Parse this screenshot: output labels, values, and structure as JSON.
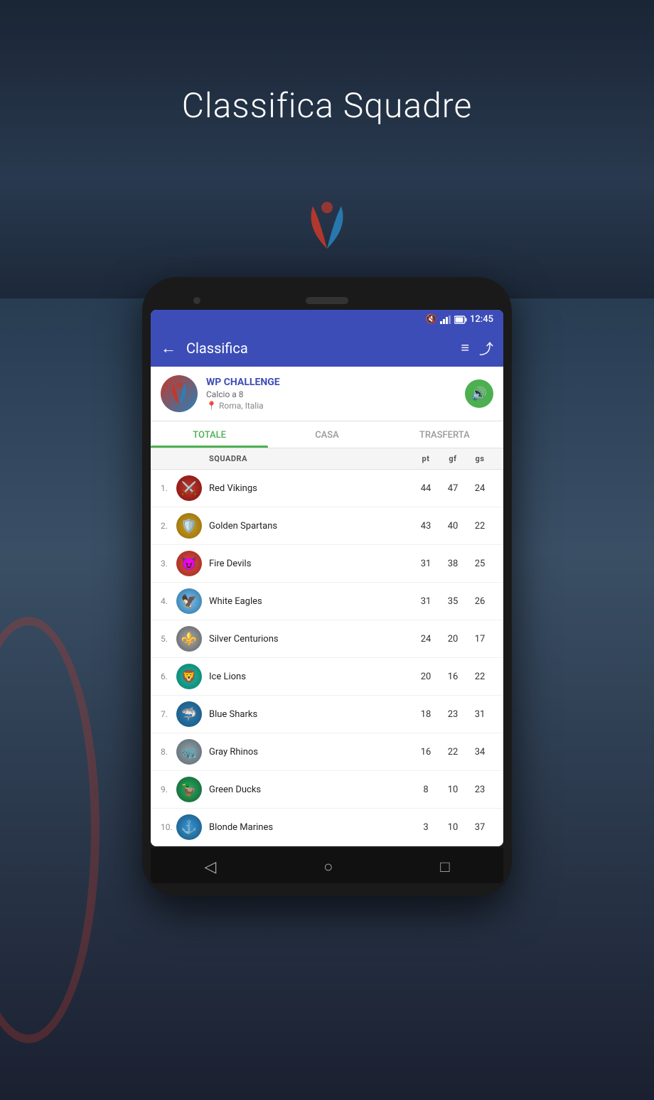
{
  "page": {
    "title": "Classifica Squadre",
    "bg_color": "#2a3a4a"
  },
  "statusBar": {
    "time": "12:45",
    "icons": [
      "mute",
      "signal",
      "battery"
    ]
  },
  "appBar": {
    "back_label": "←",
    "title": "Classifica",
    "menu_icon": "≡",
    "share_icon": "⤴"
  },
  "league": {
    "name": "WP CHALLENGE",
    "sub": "Calcio a 8",
    "location": "Roma, Italia",
    "notify_icon": "🔊"
  },
  "tabs": [
    {
      "id": "totale",
      "label": "TOTALE",
      "active": true
    },
    {
      "id": "casa",
      "label": "CASA",
      "active": false
    },
    {
      "id": "trasferta",
      "label": "TRASFERTA",
      "active": false
    }
  ],
  "tableHeader": {
    "squadra": "SQUADRA",
    "pt": "pt",
    "gf": "gf",
    "gs": "gs"
  },
  "teams": [
    {
      "rank": "1.",
      "name": "Red Vikings",
      "pt": 44,
      "gf": 47,
      "gs": 24,
      "logo_class": "logo-red-vikings",
      "emoji": "⚔️"
    },
    {
      "rank": "2.",
      "name": "Golden Spartans",
      "pt": 43,
      "gf": 40,
      "gs": 22,
      "logo_class": "logo-golden-spartans",
      "emoji": "🛡️"
    },
    {
      "rank": "3.",
      "name": "Fire Devils",
      "pt": 31,
      "gf": 38,
      "gs": 25,
      "logo_class": "logo-fire-devils",
      "emoji": "😈"
    },
    {
      "rank": "4.",
      "name": "White Eagles",
      "pt": 31,
      "gf": 35,
      "gs": 26,
      "logo_class": "logo-white-eagles",
      "emoji": "🦅"
    },
    {
      "rank": "5.",
      "name": "Silver Centurions",
      "pt": 24,
      "gf": 20,
      "gs": 17,
      "logo_class": "logo-silver-centurions",
      "emoji": "⚜️"
    },
    {
      "rank": "6.",
      "name": "Ice Lions",
      "pt": 20,
      "gf": 16,
      "gs": 22,
      "logo_class": "logo-ice-lions",
      "emoji": "🦁"
    },
    {
      "rank": "7.",
      "name": "Blue Sharks",
      "pt": 18,
      "gf": 23,
      "gs": 31,
      "logo_class": "logo-blue-sharks",
      "emoji": "🦈"
    },
    {
      "rank": "8.",
      "name": "Gray Rhinos",
      "pt": 16,
      "gf": 22,
      "gs": 34,
      "logo_class": "logo-gray-rhinos",
      "emoji": "🦏"
    },
    {
      "rank": "9.",
      "name": "Green Ducks",
      "pt": 8,
      "gf": 10,
      "gs": 23,
      "logo_class": "logo-green-ducks",
      "emoji": "🦆"
    },
    {
      "rank": "10.",
      "name": "Blonde Marines",
      "pt": 3,
      "gf": 10,
      "gs": 37,
      "logo_class": "logo-blonde-marines",
      "emoji": "⚓"
    }
  ],
  "navBar": {
    "back": "◁",
    "home": "○",
    "square": "□"
  }
}
